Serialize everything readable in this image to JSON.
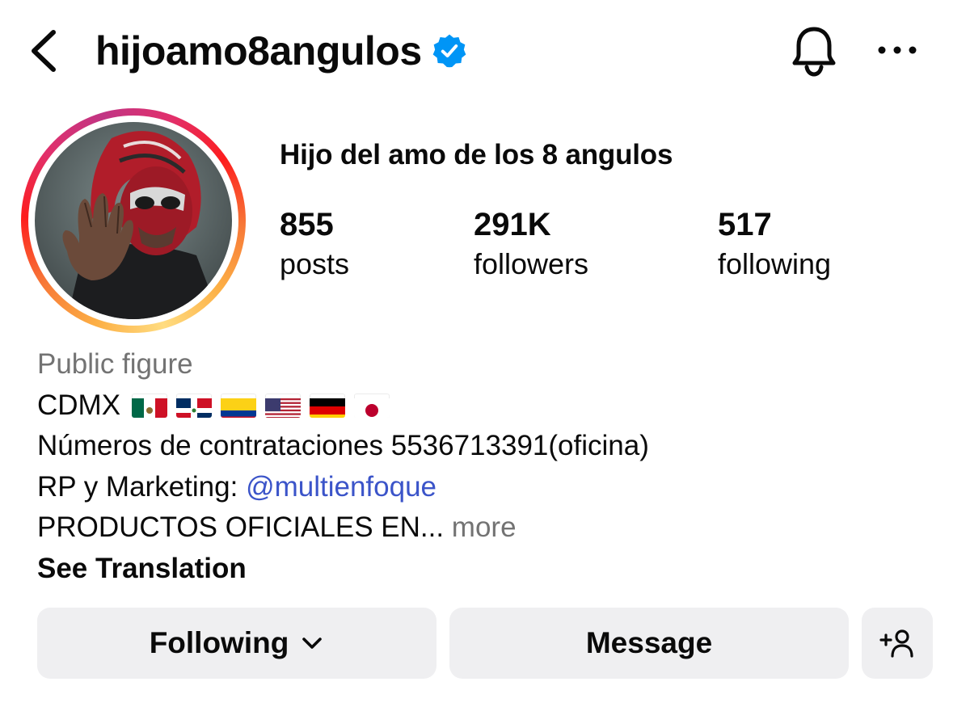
{
  "header": {
    "username": "hijoamo8angulos",
    "verified": true
  },
  "profile": {
    "full_name": "Hijo del amo de los 8 angulos",
    "stats": [
      {
        "value": "855",
        "label": "posts"
      },
      {
        "value": "291K",
        "label": "followers"
      },
      {
        "value": "517",
        "label": "following"
      }
    ]
  },
  "bio": {
    "category": "Public figure",
    "location": "CDMX",
    "flags": [
      "mexico",
      "dominican-republic",
      "colombia",
      "united-states",
      "germany",
      "japan"
    ],
    "line_contact": "Números de contrataciones 5536713391(oficina)",
    "line_pr_prefix": "RP y Marketing: ",
    "line_pr_mention": "@multienfoque",
    "line_products": "PRODUCTOS OFICIALES EN...",
    "more_label": "more",
    "translate_label": "See Translation"
  },
  "actions": {
    "following_label": "Following",
    "message_label": "Message"
  },
  "colors": {
    "verified_blue": "#0095f6",
    "mention_blue": "#3b54c9",
    "secondary_text": "#737373",
    "button_bg": "#efeff1"
  }
}
